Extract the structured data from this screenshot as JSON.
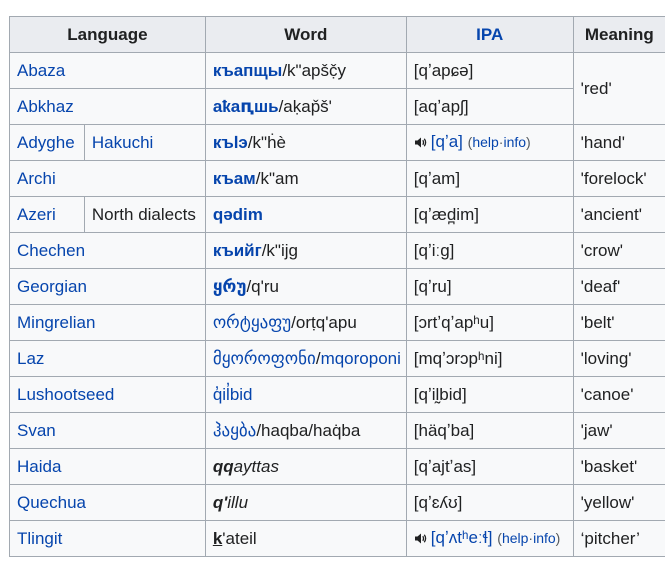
{
  "headers": {
    "language": "Language",
    "word": "Word",
    "ipa": "IPA",
    "meaning": "Meaning"
  },
  "rows": [
    {
      "language": "Abaza",
      "word_link": "къапщы",
      "word_rest": "/k\"apšč̣y",
      "ipa": "[qʼapɕə]",
      "meaning": "'red'"
    },
    {
      "language": "Abkhaz",
      "word_link": "аҟаԥшь",
      "word_rest": "/aḳap̌š'",
      "ipa": "[aqʼapʃ]"
    },
    {
      "language": "Adyghe",
      "dialect": "Hakuchi",
      "word_link": "къӏэ",
      "word_rest": "/k\"ḣè",
      "ipa": "[qʼa]",
      "help_open": "(",
      "help_link1": "help",
      "help_sep": "·",
      "help_link2": "info",
      "help_close": ")",
      "meaning": "'hand'"
    },
    {
      "language": "Archi",
      "word_link": "къам",
      "word_rest": "/k\"am",
      "ipa": "[qʼam]",
      "meaning": "'forelock'"
    },
    {
      "language": "Azeri",
      "dialect": "North dialects",
      "word_link": "qədim",
      "ipa": "[qʼæd̪im]",
      "meaning": "'ancient'"
    },
    {
      "language": "Chechen",
      "word_link": "къийг",
      "word_rest": "/k\"ijg",
      "ipa": "[qʼiːg]",
      "meaning": "'crow'"
    },
    {
      "language": "Georgian",
      "word_link": "ყრუ",
      "word_rest": "/q'ru",
      "ipa": "[qʼru]",
      "meaning": "'deaf'"
    },
    {
      "language": "Mingrelian",
      "word_link": "ორტყაფუ",
      "word_rest": "/orṭq'apu",
      "ipa": "[ɔrtʼqʼapʰu]",
      "meaning": "'belt'"
    },
    {
      "language": "Laz",
      "word_link": "მყოროფონი",
      "word_sep": "/",
      "word_link2": "mqoroponi",
      "ipa": "[mqʼɔrɔpʰni]",
      "meaning": "'loving'"
    },
    {
      "language": "Lushootseed",
      "word_link": "q̓il̓bid",
      "ipa": "[qʼil̰bid]",
      "meaning": "'canoe'"
    },
    {
      "language": "Svan",
      "word_link": "ჰაყბა",
      "word_rest": "/haqba/haq̇ba",
      "ipa": "[häqʼba]",
      "meaning": "'jaw'"
    },
    {
      "language": "Haida",
      "word_bold": "qq",
      "word_italic": "ayttas",
      "ipa": "[qʼajtʼas]",
      "meaning": "'basket'"
    },
    {
      "language": "Quechua",
      "word_bold": "q'",
      "word_italic": "illu",
      "ipa": "[qʼɛʎʊ]",
      "meaning": "'yellow'"
    },
    {
      "language": "Tlingit",
      "word_bold": "k",
      "word_rest": "'ateil",
      "ipa": "[qʼʌtʰeːɬ]",
      "help_open": "(",
      "help_link1": "help",
      "help_sep": "·",
      "help_link2": "info",
      "help_close": ")",
      "meaning": "‘pitcher’"
    }
  ],
  "icons": {
    "audio": "speaker-icon"
  },
  "colors": {
    "link": "#0645ad",
    "header_bg": "#eaecf0",
    "cell_bg": "#f8f9fa",
    "border": "#a2a9b1"
  }
}
